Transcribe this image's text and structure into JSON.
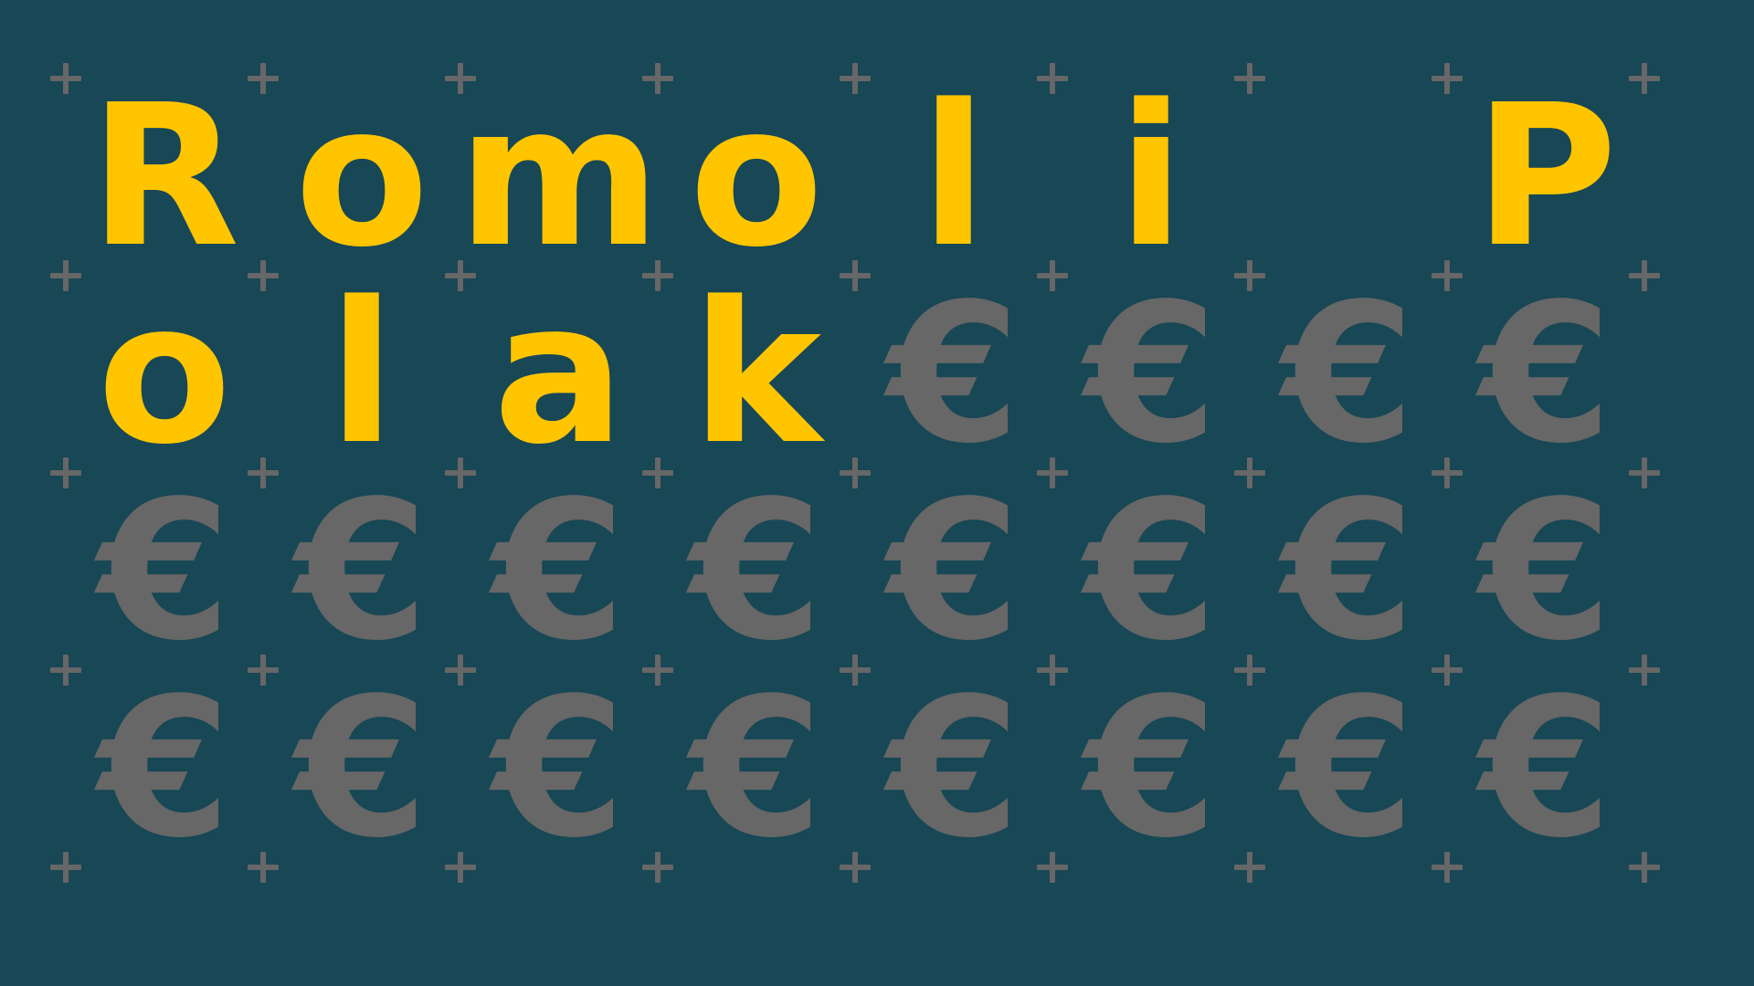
{
  "colors": {
    "background": "#184756",
    "letter": "#fec500",
    "euro": "#666766",
    "plus": "#666766"
  },
  "icons": {
    "grid_marker": "plus-icon"
  },
  "board": {
    "rows": [
      [
        "R",
        "o",
        "m",
        "o",
        "l",
        "i",
        "",
        "P"
      ],
      [
        "o",
        "l",
        "a",
        "k",
        "€",
        "€",
        "€",
        "€"
      ],
      [
        "€",
        "€",
        "€",
        "€",
        "€",
        "€",
        "€",
        "€"
      ],
      [
        "€",
        "€",
        "€",
        "€",
        "€",
        "€",
        "€",
        "€"
      ]
    ]
  }
}
